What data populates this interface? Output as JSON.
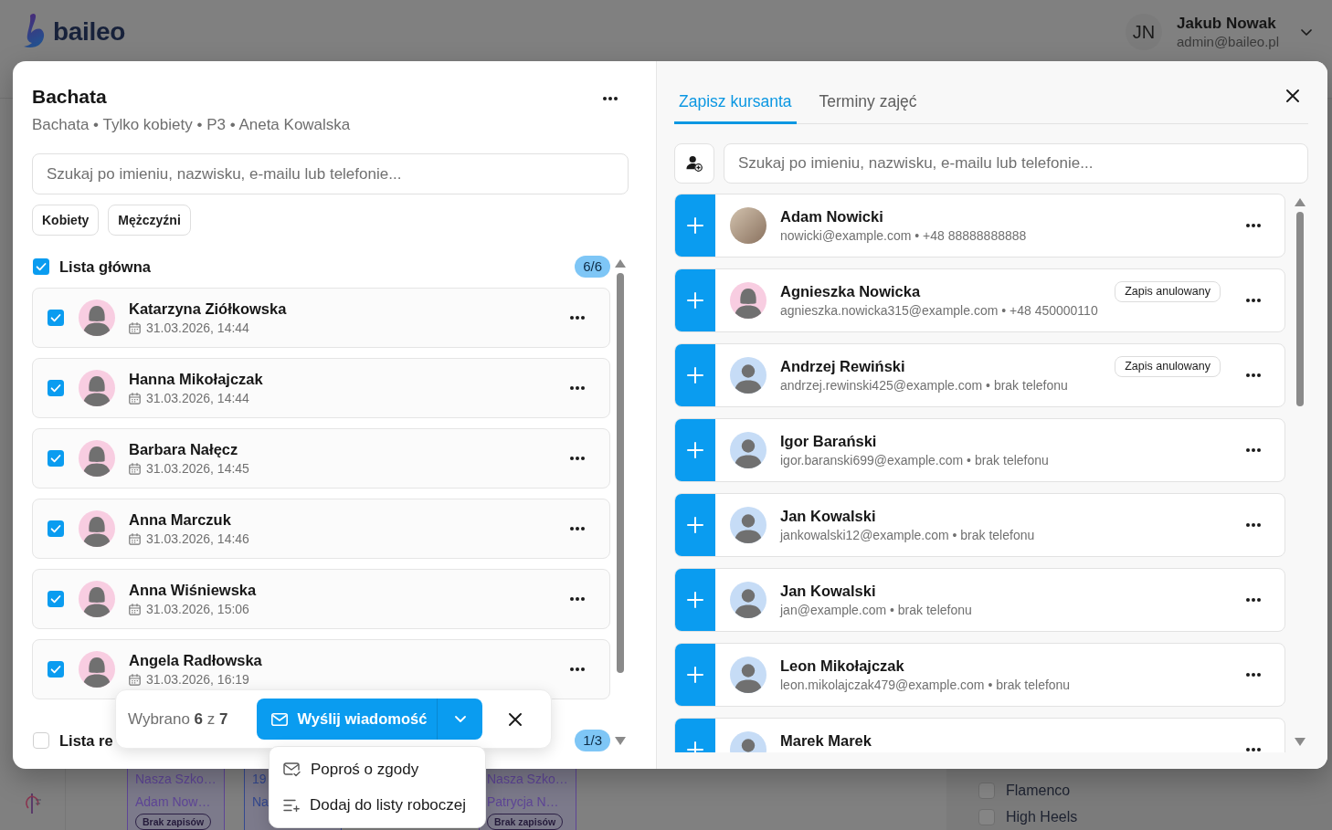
{
  "header": {
    "logo": "baileo",
    "user": {
      "initials": "JN",
      "name": "Jakub Nowak",
      "email": "admin@baileo.pl"
    }
  },
  "group_panel": {
    "title": "Bachata",
    "subtitle": "Bachata • Tylko kobiety • P3 • Aneta Kowalska",
    "search": {
      "placeholder": "Szukaj po imieniu, nazwisku, e-mailu lub telefonie..."
    },
    "gender_filters": [
      {
        "label": "Kobiety",
        "selected": false
      },
      {
        "label": "Mężczyźni",
        "selected": false
      }
    ],
    "lists": [
      {
        "title": "Lista główna",
        "checked": true,
        "count": "6/6",
        "members": [
          {
            "kind": "female",
            "name": "Katarzyna Ziółkowska",
            "date": "31.03.2026, 14:44",
            "checked": true
          },
          {
            "kind": "female",
            "name": "Hanna Mikołajczak",
            "date": "31.03.2026, 14:44",
            "checked": true
          },
          {
            "kind": "female",
            "name": "Barbara Nałęcz",
            "date": "31.03.2026, 14:45",
            "checked": true
          },
          {
            "kind": "female",
            "name": "Anna Marczuk",
            "date": "31.03.2026, 14:46",
            "checked": true
          },
          {
            "kind": "female",
            "name": "Anna Wiśniewska",
            "date": "31.03.2026, 15:06",
            "checked": true
          },
          {
            "kind": "female",
            "name": "Angela Radłowska",
            "date": "31.03.2026, 16:19",
            "checked": true
          }
        ]
      },
      {
        "title": "Lista re",
        "checked": false,
        "count": "1/3"
      }
    ]
  },
  "selection_bar": {
    "summary": "Wybrano **6** z **7**",
    "send_button": "Wyślij wiadomość",
    "menu": [
      {
        "kind": "consent",
        "label": "Poproś o zgody"
      },
      {
        "kind": "worklist",
        "label": "Dodaj do listy roboczej"
      }
    ]
  },
  "enroll_panel": {
    "tabs": [
      {
        "label": "Zapisz kursanta",
        "selected": true
      },
      {
        "label": "Terminy zajęć",
        "selected": false
      }
    ],
    "search": {
      "placeholder": "Szukaj po imieniu, nazwisku, e-mailu lub telefonie..."
    },
    "students": [
      {
        "kind": "photo",
        "name": "Adam Nowicki",
        "contact": "nowicki@example.com • +48 88888888888"
      },
      {
        "kind": "female",
        "name": "Agnieszka Nowicka",
        "contact": "agnieszka.nowicka315@example.com • +48 450000110",
        "status": "Zapis anulowany"
      },
      {
        "kind": "male",
        "name": "Andrzej Rewiński",
        "contact": "andrzej.rewinski425@example.com • brak telefonu",
        "status": "Zapis anulowany"
      },
      {
        "kind": "male",
        "name": "Igor Barański",
        "contact": "igor.baranski699@example.com • brak telefonu"
      },
      {
        "kind": "male",
        "name": "Jan Kowalski",
        "contact": "jankowalski12@example.com • brak telefonu"
      },
      {
        "kind": "male",
        "name": "Jan Kowalski",
        "contact": "jan@example.com • brak telefonu"
      },
      {
        "kind": "male",
        "name": "Leon Mikołajczak",
        "contact": "leon.mikolajczak479@example.com • brak telefonu"
      },
      {
        "kind": "male",
        "name": "Marek Marek"
      }
    ]
  },
  "calendar": {
    "cards": [
      {
        "color": "#5e4596",
        "lines": [
          "Nasza Szko…",
          "Adam Now…"
        ],
        "badge": "Brak zapisów"
      },
      {
        "color": "#34488f",
        "lines": [
          "19",
          "Na"
        ]
      },
      {
        "color": "#5e4596",
        "lines": [
          "Nasza Szko…",
          "Patrycja N…"
        ],
        "badge": "Brak zapisów"
      }
    ]
  },
  "style_filters": [
    {
      "label": "Flamenco",
      "checked": false
    },
    {
      "label": "High Heels",
      "checked": false
    }
  ]
}
